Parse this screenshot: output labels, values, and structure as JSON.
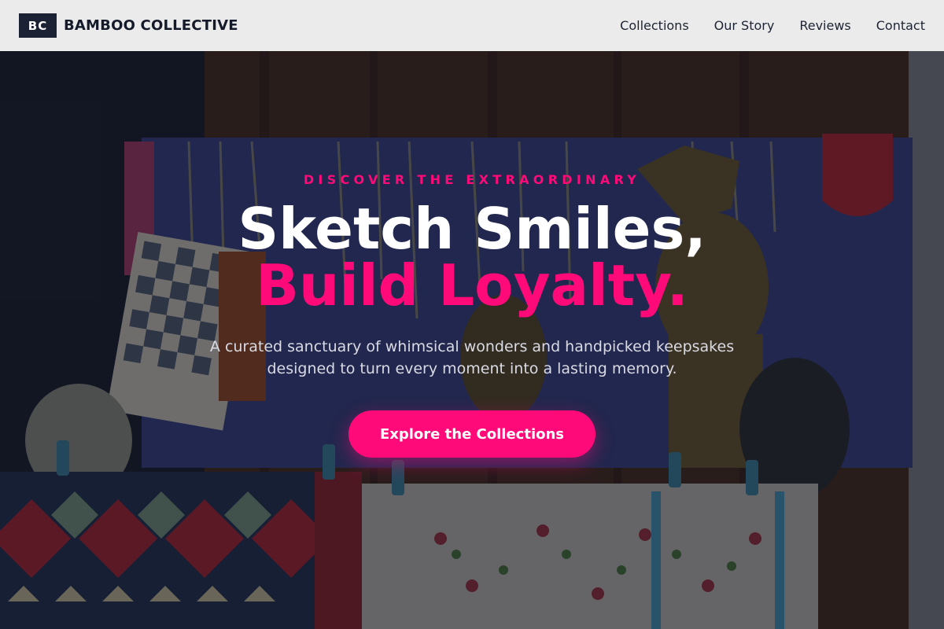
{
  "header": {
    "logo_text": "BC",
    "brand_name": "BAMBOO COLLECTIVE",
    "nav": [
      {
        "label": "Collections"
      },
      {
        "label": "Our Story"
      },
      {
        "label": "Reviews"
      },
      {
        "label": "Contact"
      }
    ]
  },
  "hero": {
    "eyebrow": "DISCOVER THE EXTRAORDINARY",
    "headline_line1": "Sketch Smiles,",
    "headline_line2": "Build Loyalty.",
    "subtitle": "A curated sanctuary of whimsical wonders and handpicked keepsakes designed to turn every moment into a lasting memory.",
    "cta_label": "Explore the Collections"
  },
  "colors": {
    "accent": "#ff0a78",
    "header_bg": "#ebebeb",
    "logo_bg": "#1b2233",
    "text_dark": "#141a2a"
  }
}
